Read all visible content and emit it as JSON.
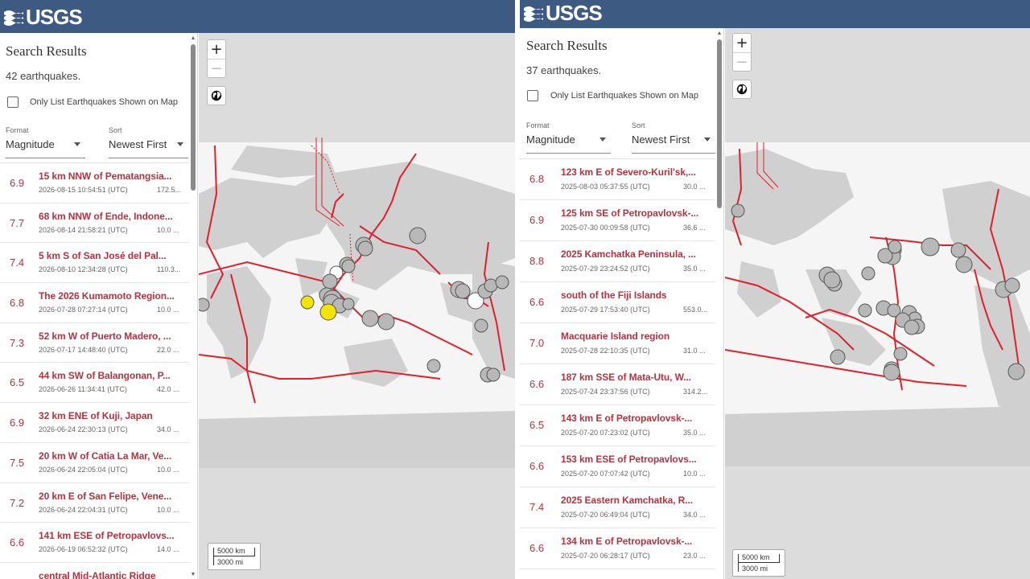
{
  "brand": {
    "logo_text": "USGS",
    "header_color": "#3c5a82"
  },
  "colors": {
    "accent_red": "#b4333f",
    "boundary_red": "#e0202a",
    "quake_gray": "#b8b8b8",
    "quake_yellow": "#f2e600",
    "quake_white": "#ffffff"
  },
  "left": {
    "title": "Search Results",
    "count": "42 earthquakes.",
    "only_list": "Only List Earthquakes Shown on Map",
    "format": {
      "label": "Format",
      "value": "Magnitude"
    },
    "sort": {
      "label": "Sort",
      "value": "Newest First"
    },
    "zoom_in": "+",
    "zoom_out": "−",
    "scale_km": "5000 km",
    "scale_mi": "3000 mi",
    "items": [
      {
        "mag": "6.9",
        "place": "15 km NNW of Pematangsia...",
        "time": "2026-08-15 10:54:51 (UTC)",
        "depth": "172.5..."
      },
      {
        "mag": "7.7",
        "place": "68 km NNW of Ende, Indone...",
        "time": "2026-08-14 21:58:21 (UTC)",
        "depth": "10.0 ..."
      },
      {
        "mag": "7.4",
        "place": "5 km S of San José del Pal...",
        "time": "2026-08-10 12:34:28 (UTC)",
        "depth": "110.3..."
      },
      {
        "mag": "6.8",
        "place": "The 2026 Kumamoto Region...",
        "time": "2026-07-28 07:27:14 (UTC)",
        "depth": "10.0 ..."
      },
      {
        "mag": "7.3",
        "place": "52 km W of Puerto Madero, ...",
        "time": "2026-07-17 14:48:40 (UTC)",
        "depth": "22.0 ..."
      },
      {
        "mag": "6.5",
        "place": "44 km SW of Balangonan, P...",
        "time": "2026-06-26 11:34:41 (UTC)",
        "depth": "42.0 ..."
      },
      {
        "mag": "6.9",
        "place": "32 km ENE of Kuji, Japan",
        "time": "2026-06-24 22:30:13 (UTC)",
        "depth": "34.0 ..."
      },
      {
        "mag": "7.5",
        "place": "20 km W of Catia La Mar, Ve...",
        "time": "2026-06-24 22:05:04 (UTC)",
        "depth": "10.0 ..."
      },
      {
        "mag": "7.2",
        "place": "20 km E of San Felipe, Vene...",
        "time": "2026-06-24 22:04:31 (UTC)",
        "depth": "10.0 ..."
      },
      {
        "mag": "6.6",
        "place": "141 km ESE of Petropavlovs...",
        "time": "2026-06-19 06:52:32 (UTC)",
        "depth": "14.0 ..."
      },
      {
        "mag": "",
        "place": "central Mid-Atlantic Ridge",
        "time": "",
        "depth": ""
      }
    ]
  },
  "right": {
    "title": "Search Results",
    "count": "37 earthquakes.",
    "only_list": "Only List Earthquakes Shown on Map",
    "format": {
      "label": "Format",
      "value": "Magnitude"
    },
    "sort": {
      "label": "Sort",
      "value": "Newest First"
    },
    "zoom_in": "+",
    "zoom_out": "−",
    "scale_km": "5000 km",
    "scale_mi": "3000 mi",
    "items": [
      {
        "mag": "6.8",
        "place": "123 km E of Severo-Kuril'sk,...",
        "time": "2025-08-03 05:37:55 (UTC)",
        "depth": "30.0 ..."
      },
      {
        "mag": "6.9",
        "place": "125 km SE of Petropavlovsk-...",
        "time": "2025-07-30 00:09:58 (UTC)",
        "depth": "36.6 ..."
      },
      {
        "mag": "8.8",
        "place": "2025 Kamchatka Peninsula, ...",
        "time": "2025-07-29 23:24:52 (UTC)",
        "depth": "35.0 ..."
      },
      {
        "mag": "6.6",
        "place": "south of the Fiji Islands",
        "time": "2025-07-29 17:53:40 (UTC)",
        "depth": "553.0..."
      },
      {
        "mag": "7.0",
        "place": "Macquarie Island region",
        "time": "2025-07-28 22:10:35 (UTC)",
        "depth": "31.0 ..."
      },
      {
        "mag": "6.6",
        "place": "187 km SSE of Mata-Utu, W...",
        "time": "2025-07-24 23:37:56 (UTC)",
        "depth": "314.2..."
      },
      {
        "mag": "6.5",
        "place": "143 km E of Petropavlovsk-...",
        "time": "2025-07-20 07:23:02 (UTC)",
        "depth": "35.0 ..."
      },
      {
        "mag": "6.6",
        "place": "153 km ESE of Petropavlovs...",
        "time": "2025-07-20 07:07:42 (UTC)",
        "depth": "10.0 ..."
      },
      {
        "mag": "7.4",
        "place": "2025 Eastern Kamchatka, R...",
        "time": "2025-07-20 06:49:04 (UTC)",
        "depth": "34.0 ..."
      },
      {
        "mag": "6.6",
        "place": "134 km E of Petropavlovsk-...",
        "time": "2025-07-20 06:28:17 (UTC)",
        "depth": "23.0 ..."
      }
    ]
  }
}
